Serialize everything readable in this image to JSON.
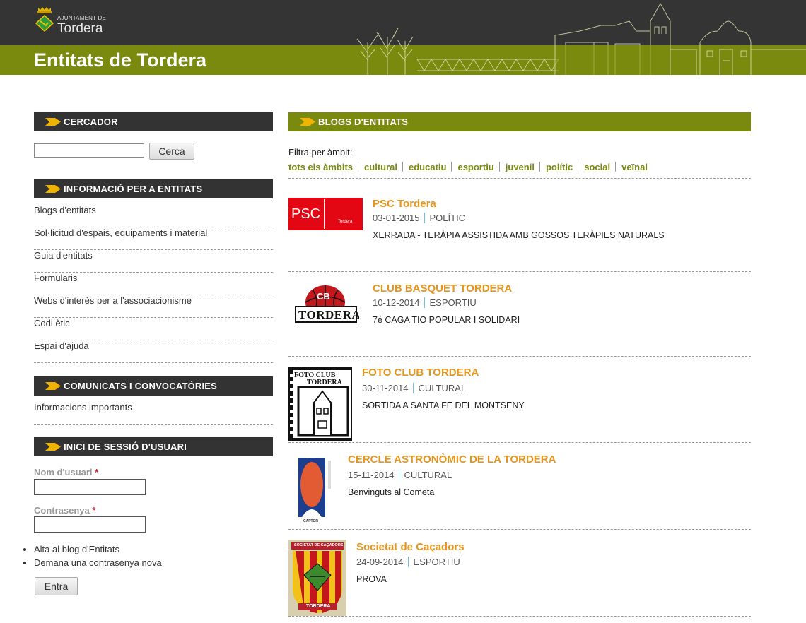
{
  "header": {
    "org_small": "AJUNTAMENT DE",
    "org_big": "Tordera",
    "site_title": "Entitats de Tordera"
  },
  "colors": {
    "olive": "#7a8a0f",
    "dark": "#333333",
    "orange": "#e8951c",
    "arrow": "#f0b400"
  },
  "search": {
    "heading": "CERCADOR",
    "button": "Cerca"
  },
  "info_menu": {
    "heading": "INFORMACIÓ PER A ENTITATS",
    "items": [
      "Blogs d'entitats",
      "Sol·licitud d'espais, equipaments i material",
      "Guia d'entitats",
      "Formularis",
      "Webs d'interès per a l'associacionisme",
      "Codi ètic",
      "Espai d'ajuda"
    ]
  },
  "comunicats": {
    "heading": "COMUNICATS I CONVOCATÒRIES",
    "items": [
      "Informacions importants"
    ]
  },
  "login": {
    "heading": "INICI DE SESSIÓ D'USUARI",
    "username_label": "Nom d'usuari",
    "password_label": "Contrasenya",
    "required_mark": "*",
    "links": [
      "Alta al blog d'Entitats",
      "Demana una contrasenya nova"
    ],
    "submit": "Entra"
  },
  "main": {
    "heading": "BLOGS D'ENTITATS",
    "filter_label": "Filtra per àmbit:",
    "filters": [
      "tots els àmbits",
      "cultural",
      "educatiu",
      "esportiu",
      "juvenil",
      "polític",
      "social",
      "veïnal"
    ],
    "posts": [
      {
        "title": "PSC Tordera",
        "date": "03-01-2015",
        "category": "POLÍTIC",
        "excerpt": "XERRADA - TERÀPIA ASSISTIDA AMB GOSSOS TERÀPIES NATURALS",
        "logo_text": "PSC",
        "logo_sub": "Tordera"
      },
      {
        "title": "CLUB BASQUET TORDERA",
        "date": "10-12-2014",
        "category": "ESPORTIU",
        "excerpt": "7é CAGA TIO POPULAR I SOLIDARI",
        "logo_text": "CB",
        "logo_sub": "TORDERA"
      },
      {
        "title": "FOTO CLUB TORDERA",
        "date": "30-11-2014",
        "category": "CULTURAL",
        "excerpt": "SORTIDA A SANTA FE DEL MONTSENY",
        "logo_text": "FOTO CLUB",
        "logo_sub": "TORDERA"
      },
      {
        "title": "CERCLE ASTRONÒMIC DE LA TORDERA",
        "date": "15-11-2014",
        "category": "CULTURAL",
        "excerpt": "Benvinguts al Cometa",
        "logo_sub": "CAPTOR"
      },
      {
        "title": "Societat de Caçadors",
        "date": "24-09-2014",
        "category": "ESPORTIU",
        "excerpt": "PROVA",
        "logo_text": "SOCIETAT DE CAÇADORS",
        "logo_sub": "TORDERA"
      }
    ]
  }
}
